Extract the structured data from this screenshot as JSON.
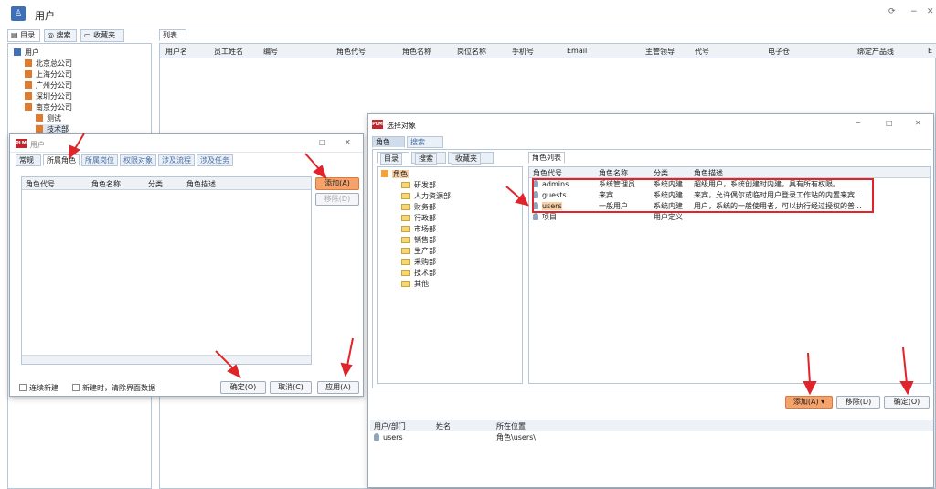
{
  "app": {
    "title": "用户"
  },
  "left_tabs": [
    "目录",
    "搜索",
    "收藏夹"
  ],
  "tree": {
    "root": "用户",
    "nodes": [
      "北京总公司",
      "上海分公司",
      "广州分公司",
      "深圳分公司",
      "南京分公司",
      "测试",
      "技术部"
    ]
  },
  "list_tab": "列表",
  "grid_headers": [
    "用户名",
    "员工姓名",
    "编号",
    "角色代号",
    "角色名称",
    "岗位名称",
    "手机号",
    "Email",
    "主管领导",
    "代号",
    "电子仓",
    "绑定产品线",
    "E"
  ],
  "user_dialog": {
    "title": "用户",
    "tabs": [
      "常规",
      "所属角色",
      "所属岗位",
      "权限对象",
      "涉及流程",
      "涉及任务"
    ],
    "columns": [
      "角色代号",
      "角色名称",
      "分类",
      "角色描述"
    ],
    "add_label": "添加(A)",
    "remove_label": "移除(D)",
    "check_continue": "连续新建",
    "check_clear": "新建时，清除界面数据",
    "ok_label": "确定(O)",
    "cancel_label": "取消(C)",
    "apply_label": "应用(A)"
  },
  "select_dialog": {
    "title": "选择对象",
    "tabs": [
      "角色",
      "搜索"
    ],
    "inner_tabs": [
      "目录",
      "搜索",
      "收藏夹"
    ],
    "tree_root": "角色",
    "tree_items": [
      "研发部",
      "人力资源部",
      "财务部",
      "行政部",
      "市场部",
      "销售部",
      "生产部",
      "采购部",
      "技术部",
      "其他"
    ],
    "list_tab": "角色列表",
    "columns": [
      "角色代号",
      "角色名称",
      "分类",
      "角色描述"
    ],
    "rows": [
      {
        "code": "admins",
        "name": "系统管理员",
        "type": "系统内建",
        "desc": "超级用户，系统创建时内建，具有所有权限。"
      },
      {
        "code": "guests",
        "name": "来宾",
        "type": "系统内建",
        "desc": "来宾，允许偶尔或临时用户登录工作站的内置来宾..."
      },
      {
        "code": "users",
        "name": "一般用户",
        "type": "系统内建",
        "desc": "用户，系统的一般使用者，可以执行经过授权的普..."
      },
      {
        "code": "项目",
        "name": "",
        "type": "用户定义",
        "desc": ""
      }
    ],
    "add_label": "添加(A)",
    "remove_label": "移除(D)",
    "ok_label": "确定(O)",
    "bottom_columns": [
      "用户/部门",
      "姓名",
      "所在位置"
    ],
    "bottom_row": {
      "user": "users",
      "name": "",
      "location": "角色\\users\\"
    }
  },
  "colors": {
    "accent": "#f6a26b",
    "highlight": "#e0242b",
    "brand": "#c0262b"
  }
}
